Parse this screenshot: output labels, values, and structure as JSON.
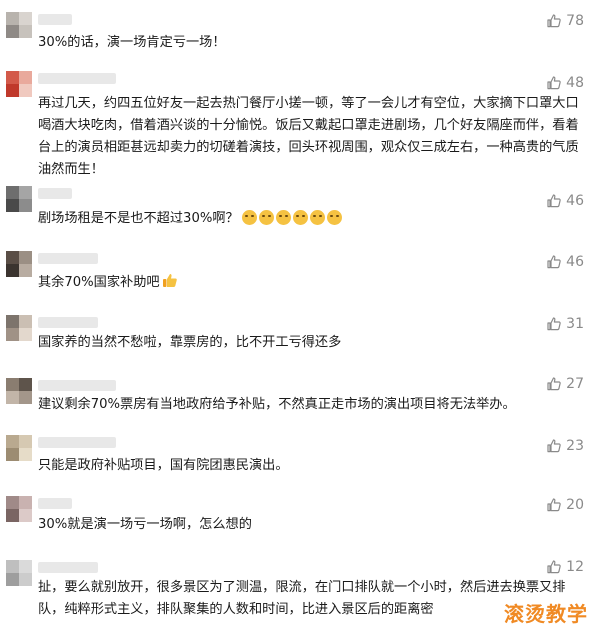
{
  "comments": [
    {
      "likes": "78",
      "text": "30%的话，演一场肯定亏一场！"
    },
    {
      "likes": "48",
      "text": "再过几天，约四五位好友一起去热门餐厅小搓一顿，等了一会儿才有空位，大家摘下口罩大口喝酒大块吃肉，借着酒兴谈的十分愉悦。饭后又戴起口罩走进剧场，几个好友隔座而伴，看着台上的演员相距甚远却卖力的切磋着演技，回头环视周围，观众仅三成左右，一种高贵的气质油然而生！"
    },
    {
      "likes": "46",
      "text": "剧场场租是不是也不超过30%啊？"
    },
    {
      "likes": "46",
      "text": "其余70%国家补助吧"
    },
    {
      "likes": "31",
      "text": "国家养的当然不愁啦，靠票房的，比不开工亏得还多"
    },
    {
      "likes": "27",
      "text": "建议剩余70%票房有当地政府给予补贴，不然真正走市场的演出项目将无法举办。"
    },
    {
      "likes": "23",
      "text": "只能是政府补贴项目，国有院团惠民演出。"
    },
    {
      "likes": "20",
      "text": "30%就是演一场亏一场啊，怎么想的"
    },
    {
      "likes": "12",
      "text": "扯，要么就别放开，很多景区为了测温，限流，在门口排队就一个小时，然后进去换票又排队，纯粹形式主义，排队聚集的人数和时间，比进入景区后的距离密"
    }
  ],
  "watermark": "滚烫教学",
  "icons": {
    "like": "thumb-up-outline-icon",
    "emoji": "smiley-emoji-icon",
    "thumbs": "thumbs-up-emoji-icon"
  }
}
